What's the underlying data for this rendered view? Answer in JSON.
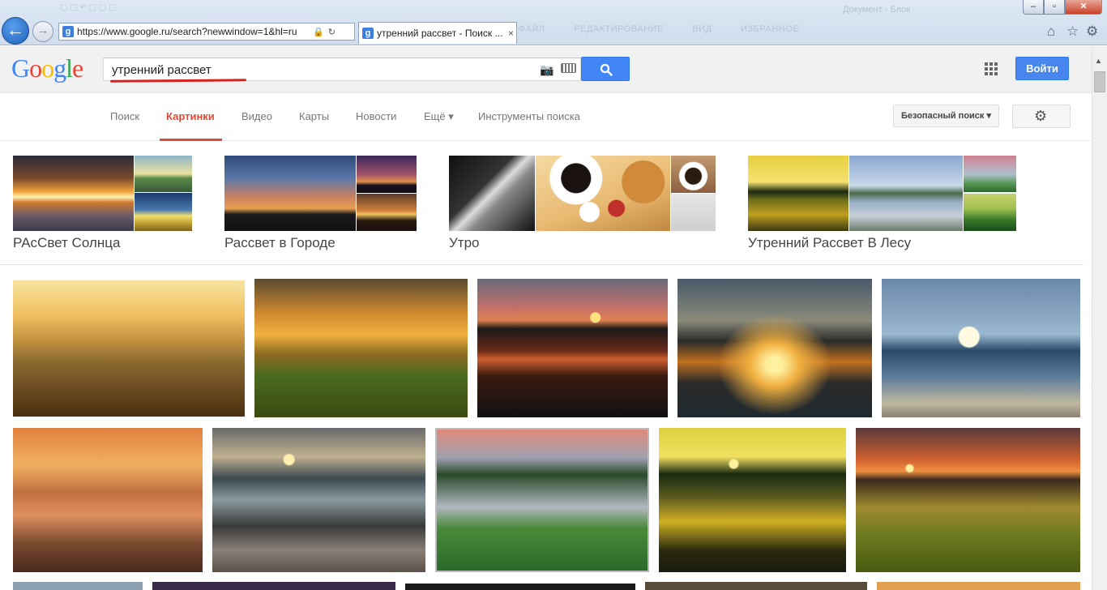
{
  "browser": {
    "address_url": "https://www.google.ru/search?newwindow=1&hl=ru",
    "tab_title": "утренний рассвет - Поиск ...",
    "tab_close": "×",
    "faded_menu": [
      "ФАЙЛ",
      "РЕДАКТИРОВАНИЕ",
      "ВИД",
      "ИЗБРАННОЕ"
    ],
    "faded_window_title": "Документ - Блок",
    "back_glyph": "←",
    "forward_glyph": "→",
    "home_icon": "⌂",
    "favorites_icon": "☆",
    "tools_icon": "⚙",
    "lock_icon": "🔒",
    "refresh_icon": "↻",
    "minimize": "–",
    "maximize": "▫",
    "close": "✕"
  },
  "google": {
    "logo_letters": [
      {
        "ch": "G",
        "color": "#4285f4"
      },
      {
        "ch": "o",
        "color": "#ea4335"
      },
      {
        "ch": "o",
        "color": "#fbbc05"
      },
      {
        "ch": "g",
        "color": "#4285f4"
      },
      {
        "ch": "l",
        "color": "#34a853"
      },
      {
        "ch": "e",
        "color": "#ea4335"
      }
    ],
    "query": "утренний рассвет",
    "signin": "Войти"
  },
  "tabs": {
    "search": "Поиск",
    "images": "Картинки",
    "video": "Видео",
    "maps": "Карты",
    "news": "Новости",
    "more": "Ещё ▾",
    "tools": "Инструменты поиска"
  },
  "safe_search": "Безопасный поиск ▾",
  "settings_icon": "⚙",
  "related": [
    {
      "label": "РАсСвет Солнца"
    },
    {
      "label": "Рассвет в Городе"
    },
    {
      "label": "Утро"
    },
    {
      "label": "Утренний Рассвет В Лесу"
    }
  ],
  "accent_colors": {
    "search_blue": "#4285f4",
    "images_red": "#dd4b39",
    "underline_red": "#d7231f"
  }
}
